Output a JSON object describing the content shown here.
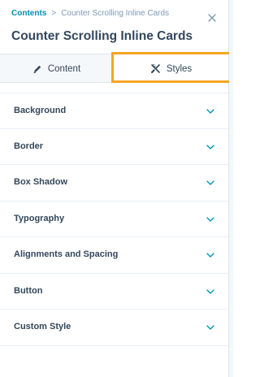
{
  "breadcrumb": {
    "root": "Contents",
    "separator": ">",
    "current": "Counter Scrolling Inline Cards"
  },
  "header": {
    "title": "Counter Scrolling Inline Cards",
    "close_icon": "close-icon"
  },
  "tabs": [
    {
      "label": "Content",
      "icon": "pencil-icon",
      "active": false
    },
    {
      "label": "Styles",
      "icon": "brush-ruler-icon",
      "active": true
    }
  ],
  "sections": [
    {
      "label": "Background"
    },
    {
      "label": "Border"
    },
    {
      "label": "Box Shadow"
    },
    {
      "label": "Typography"
    },
    {
      "label": "Alignments and Spacing"
    },
    {
      "label": "Button"
    },
    {
      "label": "Custom Style"
    }
  ],
  "colors": {
    "link": "#0091ae",
    "text": "#33475b",
    "muted": "#7c98b6",
    "highlight": "#f5a623",
    "tab_bg": "#f5f8fa"
  }
}
